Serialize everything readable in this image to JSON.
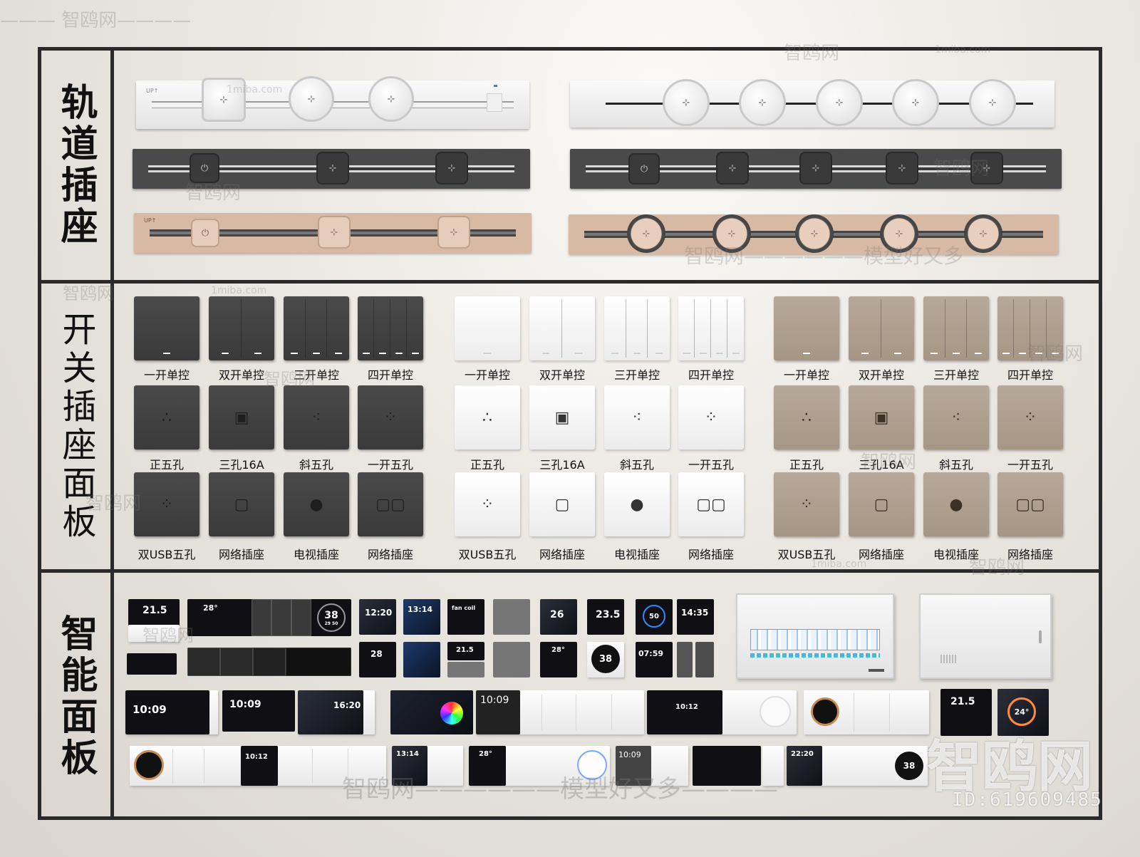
{
  "sections": {
    "track": "轨道插座",
    "panels": "开关插座面板",
    "smart": "智能面板"
  },
  "track_items": {
    "tag_up": "UP↑",
    "power_glyph": "⏻",
    "socket_glyph": "⊹"
  },
  "switch_labels": [
    "一开单控",
    "双开单控",
    "三开单控",
    "四开单控"
  ],
  "socket_labels": [
    "正五孔",
    "三孔16A",
    "斜五孔",
    "一开五孔"
  ],
  "data_labels": [
    "双USB五孔",
    "网络插座",
    "电视插座",
    "网络插座"
  ],
  "panel_colors": {
    "dark": "#3f3f3f",
    "white": "#f4f4f4",
    "beige": "#ad9d8d"
  },
  "icons": {
    "socket_five": "five-hole-socket-icon",
    "socket_16a": "three-hole-16a-icon",
    "usb": "usb-icon",
    "network": "network-port-icon",
    "tv": "tv-port-icon"
  },
  "smart_screens": {
    "s1": "21.5",
    "s2": "28°",
    "s3": "38",
    "s3b": "29 50",
    "s4": "12:20",
    "s5": "13:14",
    "s6": "fan coil",
    "s7": "26",
    "s8": "23.5",
    "s9": "50",
    "s10": "14:35",
    "s11": "28",
    "s12": "21.5",
    "s13": "28°",
    "s14": "38",
    "s15": "07:59",
    "s16": "10:09",
    "s17": "10:09",
    "s18": "16:20",
    "s19": "10:09",
    "s20": "10:12",
    "s21": "21.5",
    "s22": "24°",
    "s23": "10:12",
    "s24": "13:14",
    "s25": "28°",
    "s26": "10:09",
    "s27": "22:20",
    "s28": "38"
  },
  "watermarks": {
    "site": "智鸥网",
    "site_url": "1miba.com",
    "slogan": "智鸥网——————模型好又多",
    "slogan2": "智鸥网——————模型好又多————",
    "dash_site": "——— 智鸥网————",
    "big": "智鸥网",
    "id": "ID:619609485"
  }
}
